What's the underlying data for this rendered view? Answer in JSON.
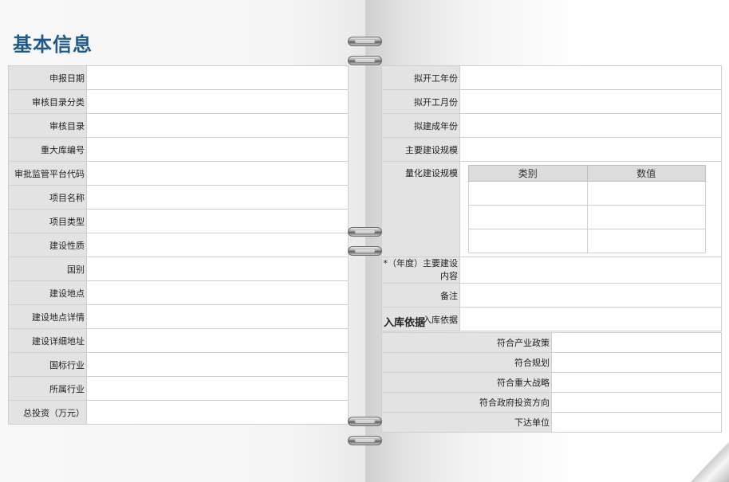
{
  "page_title": "基本信息",
  "left_fields": [
    {
      "label": "申报日期"
    },
    {
      "label": "审核目录分类"
    },
    {
      "label": "审核目录"
    },
    {
      "label": "重大库编号"
    },
    {
      "label": "审批监管平台代码"
    },
    {
      "label": "项目名称"
    },
    {
      "label": "项目类型"
    },
    {
      "label": "建设性质"
    },
    {
      "label": "国别"
    },
    {
      "label": "建设地点"
    },
    {
      "label": "建设地点详情"
    },
    {
      "label": "建设详细地址"
    },
    {
      "label": "国标行业"
    },
    {
      "label": "所属行业"
    },
    {
      "label": "总投资（万元）"
    }
  ],
  "right_fields": {
    "start_year": "拟开工年份",
    "start_month": "拟开工月份",
    "completion_year": "拟建成年份",
    "main_scale": "主要建设规模",
    "quantified_scale": "量化建设规模",
    "annual_content_line1": "*（年度）主要建设",
    "annual_content_line2": "内容",
    "remark": "备注",
    "storage_basis": "入库依据"
  },
  "quantified_table": {
    "headers": [
      "类别",
      "数值"
    ],
    "rows": [
      [
        "",
        ""
      ],
      [
        "",
        ""
      ],
      [
        "",
        ""
      ]
    ]
  },
  "basis_section": {
    "title": "入库依据",
    "fields": [
      {
        "label": "符合产业政策"
      },
      {
        "label": "符合规划"
      },
      {
        "label": "符合重大战略"
      },
      {
        "label": "符合政府投资方向"
      },
      {
        "label": "下达单位"
      }
    ]
  }
}
